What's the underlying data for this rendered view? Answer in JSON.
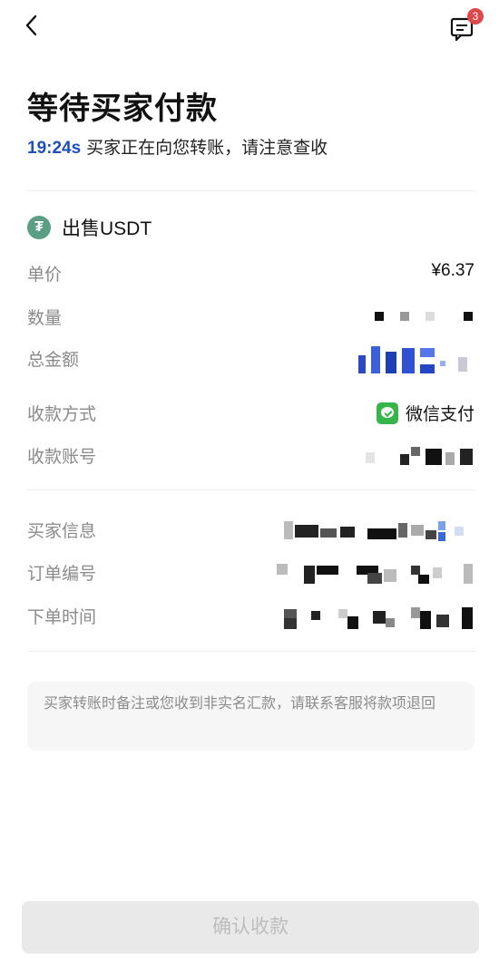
{
  "nav": {
    "back_icon": "back-chevron-icon",
    "message_icon": "message-icon",
    "badge_count": "3"
  },
  "header": {
    "title": "等待买家付款",
    "countdown": "19:24s",
    "status_text": "买家正在向您转账，请注意查收"
  },
  "asset": {
    "icon": "tether-icon",
    "icon_glyph": "₮",
    "label": "出售USDT"
  },
  "details": {
    "unit_price_label": "单价",
    "unit_price_value": "¥6.37",
    "quantity_label": "数量",
    "total_label": "总金额",
    "pay_method_label": "收款方式",
    "pay_method_value": "微信支付",
    "pay_account_label": "收款账号",
    "buyer_info_label": "买家信息",
    "order_no_label": "订单编号",
    "order_time_label": "下单时间"
  },
  "notice": {
    "text": "买家转账时备注或您收到非实名汇款，请联系客服将款项退回"
  },
  "actions": {
    "confirm_label": "确认收款"
  },
  "colors": {
    "accent_blue": "#1d4fbf",
    "tether_green": "#5a9e84",
    "wechat_green": "#35b54a",
    "badge_red": "#e0474c"
  }
}
